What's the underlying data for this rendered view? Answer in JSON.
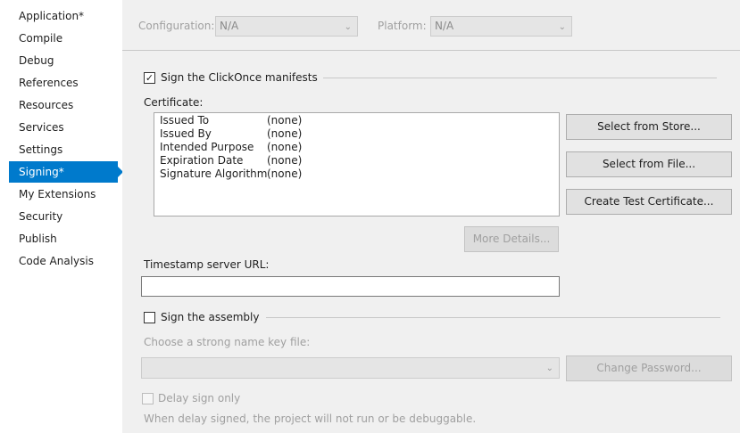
{
  "sidebar": {
    "items": [
      {
        "label": "Application*"
      },
      {
        "label": "Compile"
      },
      {
        "label": "Debug"
      },
      {
        "label": "References"
      },
      {
        "label": "Resources"
      },
      {
        "label": "Services"
      },
      {
        "label": "Settings"
      },
      {
        "label": "Signing*",
        "active": true
      },
      {
        "label": "My Extensions"
      },
      {
        "label": "Security"
      },
      {
        "label": "Publish"
      },
      {
        "label": "Code Analysis"
      }
    ]
  },
  "toolbar": {
    "configuration_label": "Configuration:",
    "configuration_value": "N/A",
    "platform_label": "Platform:",
    "platform_value": "N/A"
  },
  "clickonce": {
    "checkbox_label": "Sign the ClickOnce manifests",
    "checked": true,
    "certificate_label": "Certificate:",
    "fields": [
      {
        "key": "Issued To",
        "value": "(none)"
      },
      {
        "key": "Issued By",
        "value": "(none)"
      },
      {
        "key": "Intended Purpose",
        "value": "(none)"
      },
      {
        "key": "Expiration Date",
        "value": "(none)"
      },
      {
        "key": "Signature Algorithm",
        "value": "(none)"
      }
    ],
    "select_from_store": "Select from Store...",
    "select_from_file": "Select from File...",
    "create_test_certificate": "Create Test Certificate...",
    "more_details": "More Details...",
    "timestamp_label": "Timestamp server URL:",
    "timestamp_value": ""
  },
  "assembly": {
    "checkbox_label": "Sign the assembly",
    "checked": false,
    "key_file_label": "Choose a strong name key file:",
    "key_file_value": "",
    "change_password": "Change Password...",
    "delay_sign_label": "Delay sign only",
    "delay_sign_checked": false,
    "delay_note": "When delay signed, the project will not run or be debuggable."
  },
  "colors": {
    "accent": "#007acc",
    "sidebar_bg": "#ffffff",
    "panel_bg": "#f0f0f0"
  }
}
